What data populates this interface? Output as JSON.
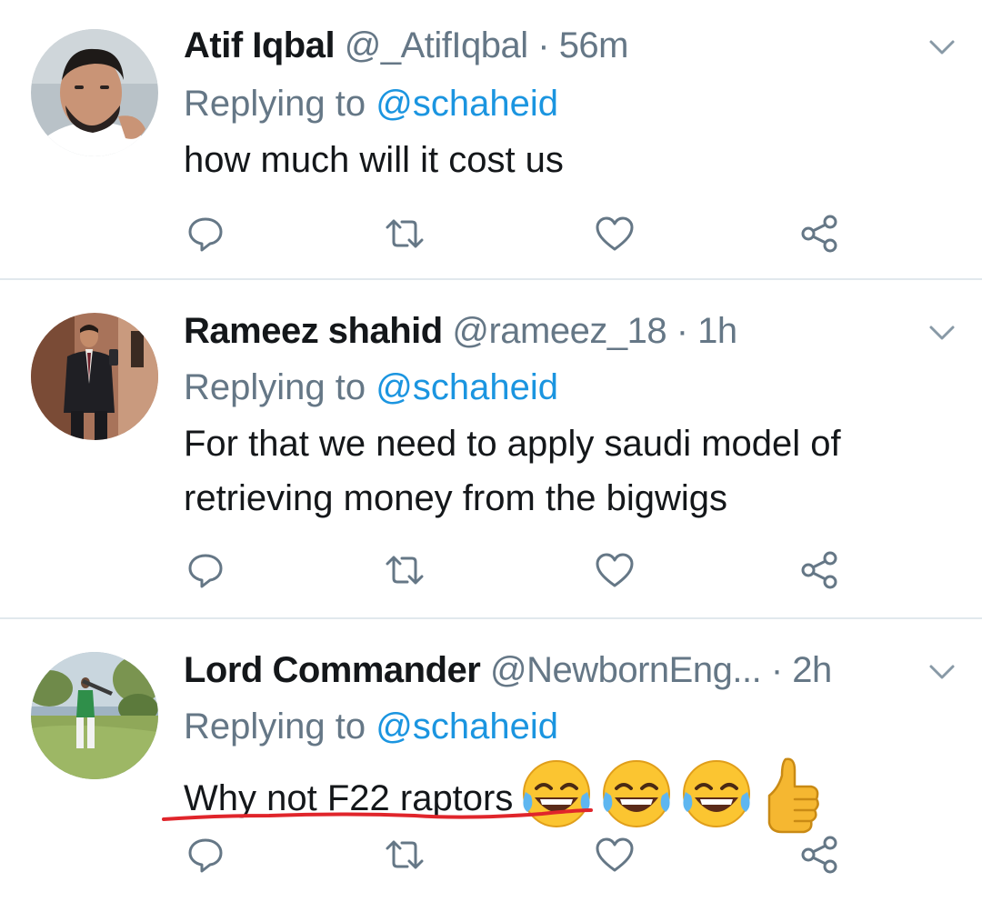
{
  "colors": {
    "name": "#14171a",
    "muted": "#657786",
    "link": "#1b95e0",
    "divider": "#e1e8ed",
    "underline": "#e0252b"
  },
  "tweets": [
    {
      "name": "Atif Iqbal",
      "handle": "@_AtifIqbal",
      "dot": "·",
      "time": "56m",
      "replying_prefix": "Replying to",
      "replying_to": "@schaheid",
      "text_lines": [
        "how much will it cost us"
      ]
    },
    {
      "name": "Rameez shahid",
      "handle": "@rameez_18",
      "dot": "·",
      "time": "1h",
      "replying_prefix": "Replying to",
      "replying_to": "@schaheid",
      "text_lines": [
        "For that we need to apply saudi model of",
        "retrieving money from the bigwigs"
      ]
    },
    {
      "name": "Lord Commander",
      "handle": "@NewbornEng...",
      "dot": "·",
      "time": "2h",
      "replying_prefix": "Replying to",
      "replying_to": "@schaheid",
      "text_lines": [
        "Why not F22 raptors"
      ],
      "emojis": [
        "face-with-tears-of-joy",
        "face-with-tears-of-joy",
        "face-with-tears-of-joy",
        "thumbs-up"
      ]
    }
  ],
  "icons": {
    "reply": "reply-icon",
    "retweet": "retweet-icon",
    "like": "heart-icon",
    "share": "share-icon",
    "more": "chevron-down-icon"
  }
}
